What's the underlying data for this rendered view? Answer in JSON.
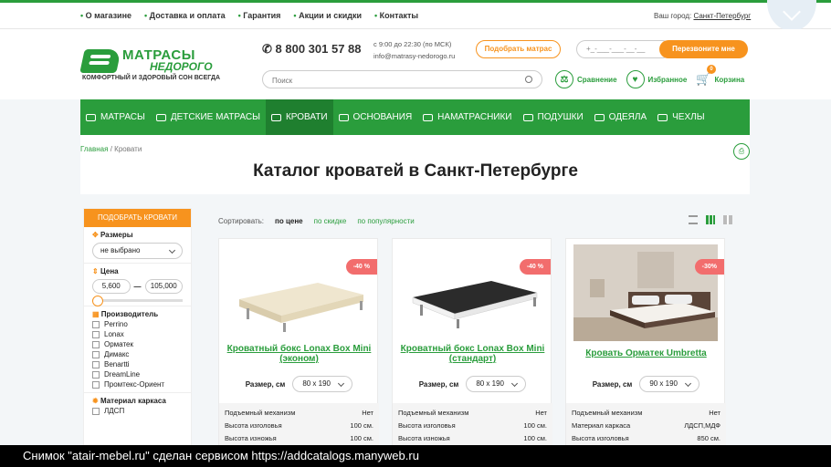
{
  "topnav": [
    "О магазине",
    "Доставка и оплата",
    "Гарантия",
    "Акции и скидки",
    "Контакты"
  ],
  "city_label": "Ваш город:",
  "city": "Санкт-Петербург",
  "logo": {
    "line1": "МАТРАСЫ",
    "line2": "НЕДОРОГО",
    "tagline": "КОМФОРТНЫЙ И ЗДОРОВЫЙ СОН ВСЕГДА"
  },
  "phone": "8 800 301 57 88",
  "hours": "с 9:00 до 22:30 (по МСК)",
  "email": "info@matrasy-nedorogo.ru",
  "pick_button": "Подобрать матрас",
  "phone_placeholder": "+_-___-___-__-__",
  "call_button": "Перезвоните мне",
  "search_placeholder": "Поиск",
  "header_links": {
    "compare": "Сравнение",
    "favorites": "Избранное",
    "cart": "Корзина",
    "cart_count": "0"
  },
  "menu": [
    "МАТРАСЫ",
    "ДЕТСКИЕ МАТРАСЫ",
    "КРОВАТИ",
    "ОСНОВАНИЯ",
    "НАМАТРАСНИКИ",
    "ПОДУШКИ",
    "ОДЕЯЛА",
    "ЧЕХЛЫ"
  ],
  "breadcrumb": {
    "home": "Главная",
    "sep": "/",
    "current": "Кровати"
  },
  "title": "Каталог кроватей в Санкт-Петербурге",
  "filter": {
    "header": "ПОДОБРАТЬ КРОВАТИ",
    "size_label": "Размеры",
    "size_value": "не выбрано",
    "price_label": "Цена",
    "price_min": "5,600",
    "price_max": "105,000",
    "maker_label": "Производитель",
    "makers": [
      "Perrino",
      "Lonax",
      "Орматек",
      "Димакс",
      "Benartti",
      "DreamLine",
      "Промтекс-Ориент"
    ],
    "frame_label": "Материал каркаса",
    "frames": [
      "ЛДСП"
    ]
  },
  "sort": {
    "label": "Сортировать:",
    "price": "по цене",
    "discount": "по скидке",
    "popular": "по популярности"
  },
  "products": [
    {
      "discount": "-40 %",
      "name": "Кроватный бокс Lonax Box Mini (эконом)",
      "size_label": "Размер, см",
      "size": "80 x 190",
      "specs": [
        [
          "Подъемный механизм",
          "Нет"
        ],
        [
          "Высота изголовья",
          "100 см."
        ],
        [
          "Высота изножья",
          "100 см."
        ]
      ]
    },
    {
      "discount": "-40 %",
      "name": "Кроватный бокс Lonax Box Mini (стандарт)",
      "size_label": "Размер, см",
      "size": "80 x 190",
      "specs": [
        [
          "Подъемный механизм",
          "Нет"
        ],
        [
          "Высота изголовья",
          "100 см."
        ],
        [
          "Высота изножья",
          "100 см."
        ]
      ]
    },
    {
      "discount": "-30%",
      "name": "Кровать Орматек Umbretta",
      "size_label": "Размер, см",
      "size": "90 x 190",
      "specs": [
        [
          "Подъемный механизм",
          "Нет"
        ],
        [
          "Материал каркаса",
          "ЛДСП,МДФ"
        ],
        [
          "Высота изголовья",
          "850 см."
        ]
      ]
    }
  ],
  "footer_text": "Снимок \"atair-mebel.ru\" сделан сервисом https://addcatalogs.manyweb.ru",
  "colors": {
    "green": "#2a9d3c",
    "orange": "#f7931e",
    "discount": "#f26d6d"
  }
}
